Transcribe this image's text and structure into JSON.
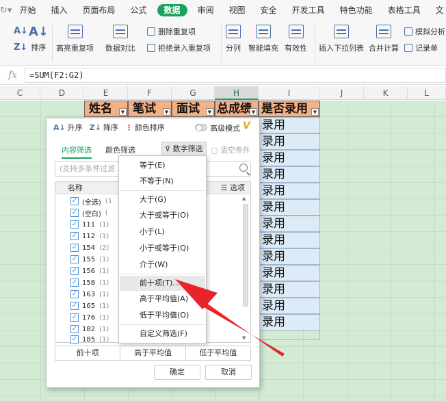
{
  "menubar": {
    "tabs": [
      "开始",
      "插入",
      "页面布局",
      "公式",
      "数据",
      "审阅",
      "视图",
      "安全",
      "开发工具",
      "特色功能",
      "表格工具",
      "文"
    ],
    "active": "数据"
  },
  "ribbon": {
    "sort": "排序",
    "highlight_dup": "高亮重复项",
    "compare": "数据对比",
    "delete_dup": "删除重复项",
    "reject_dup": "拒绝录入重复项",
    "split": "分列",
    "smart_fill": "智能填充",
    "validity": "有效性",
    "insert_dropdown": "插入下拉列表",
    "merge_calc": "合并计算",
    "simulate": "模拟分析",
    "record": "记录单"
  },
  "formula_bar": {
    "fx": "fx",
    "formula": "=SUM(F2:G2)"
  },
  "columns": [
    "C",
    "D",
    "E",
    "F",
    "G",
    "H",
    "I",
    "J",
    "K",
    "L"
  ],
  "header_cells": [
    "姓名",
    "笔试",
    "面试",
    "总成绩",
    "是否录用"
  ],
  "column_i_values": [
    "录用",
    "录用",
    "录用",
    "录用",
    "录用",
    "录用",
    "录用",
    "录用",
    "录用",
    "录用",
    "录用",
    "录用",
    "录用"
  ],
  "filter_panel": {
    "asc": "升序",
    "desc": "降序",
    "color_sort": "颜色排序",
    "advanced": "高级模式",
    "tab_content": "内容筛选",
    "tab_color": "颜色筛选",
    "number_filter": "数字筛选",
    "clear": "清空条件",
    "search_placeholder": "(支持多条件过滤",
    "list_header": "名称",
    "options": "选项",
    "items": [
      {
        "label": "(全选)",
        "count": "(1"
      },
      {
        "label": "(空白)",
        "count": "("
      },
      {
        "label": "111",
        "count": "(1)"
      },
      {
        "label": "112",
        "count": "(1)"
      },
      {
        "label": "154",
        "count": "(2)"
      },
      {
        "label": "155",
        "count": "(1)"
      },
      {
        "label": "156",
        "count": "(1)"
      },
      {
        "label": "158",
        "count": "(1)"
      },
      {
        "label": "163",
        "count": "(1)"
      },
      {
        "label": "165",
        "count": "(1)"
      },
      {
        "label": "176",
        "count": "(1)"
      },
      {
        "label": "182",
        "count": "(1)"
      },
      {
        "label": "185",
        "count": "(1)"
      }
    ],
    "bottom_top10": "前十项",
    "bottom_above_avg": "高于平均值",
    "bottom_below_avg": "低于平均值",
    "ok": "确定",
    "cancel": "取消"
  },
  "dropdown": {
    "items": [
      "等于(E)",
      "不等于(N)",
      "大于(G)",
      "大于或等于(O)",
      "小于(L)",
      "小于或等于(Q)",
      "介于(W)",
      "前十项(T)...",
      "高于平均值(A)",
      "低于平均值(O)",
      "自定义筛选(F)"
    ],
    "highlighted": "前十项(T)..."
  },
  "colors": {
    "accent": "#1aa35a",
    "grid_bg": "#d3ebd3",
    "header_fill": "#f4b183",
    "cell_fill": "#ddebf7",
    "arrow": "#e8242a"
  }
}
